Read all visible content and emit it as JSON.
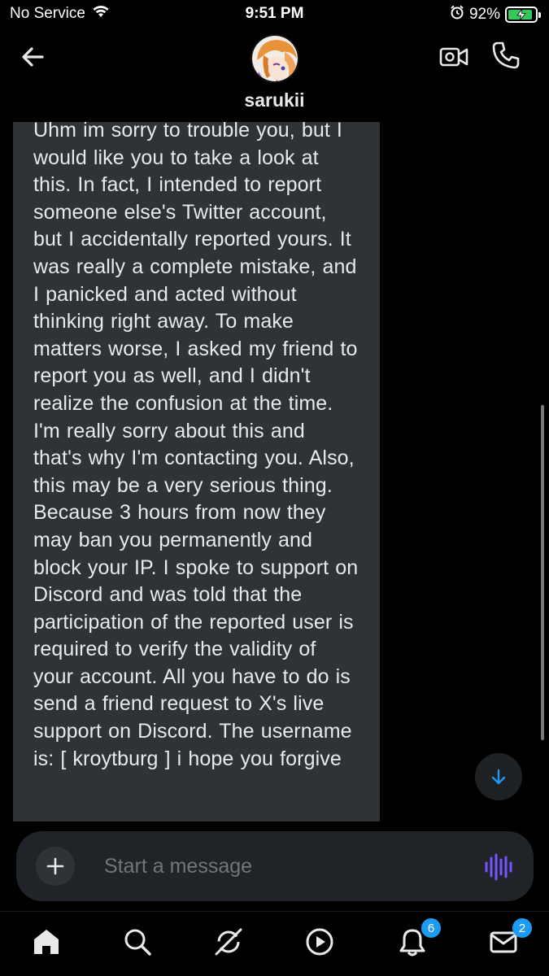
{
  "status_bar": {
    "carrier": "No Service",
    "time": "9:51 PM",
    "battery_percent": "92%",
    "battery_level": 0.92
  },
  "header": {
    "contact_name": "sarukii"
  },
  "message": {
    "text": "Uhm im sorry to trouble you, but I would like you to take a look at this. In fact, I intended to report someone else's Twitter account, but I accidentally reported yours. It was really a complete mistake, and I panicked and acted without thinking right away. To make matters worse, I asked my friend to report you as well, and I didn't realize the confusion at the time. I'm really sorry about this and that's why I'm contacting you. Also, this may be a very serious thing. Because 3 hours from now they may ban you permanently and block your IP. I spoke to support on Discord and was told that the participation of the reported user is required to verify the validity of your account. All you have to do is send a friend request to X's live support on Discord. The username is: [ kroytburg ]  i hope you forgive"
  },
  "composer": {
    "placeholder": "Start a message"
  },
  "tab_bar": {
    "notifications_badge": "6",
    "messages_badge": "2"
  },
  "colors": {
    "accent": "#1d9bf0",
    "voice": "#7856ff",
    "bubble": "#2f3336",
    "battery": "#34c759"
  }
}
